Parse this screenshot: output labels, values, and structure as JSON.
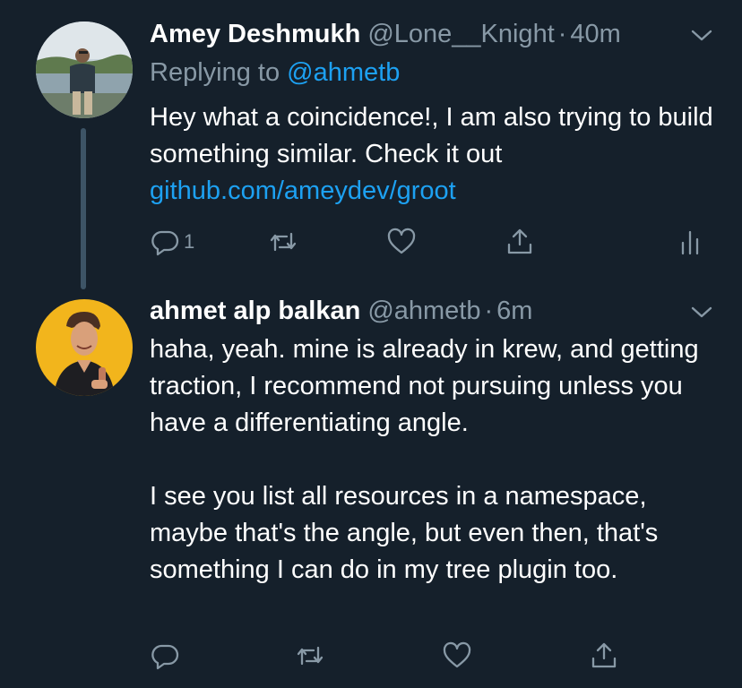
{
  "tweets": [
    {
      "author": "Amey Deshmukh",
      "handle": "@Lone__Knight",
      "separator": "·",
      "time": "40m",
      "replying_prefix": "Replying to",
      "replying_to": "@ahmetb",
      "text": "Hey what a coincidence!, I am also trying to build something similar. Check it out",
      "link": "github.com/ameydev/groot",
      "reply_count": "1",
      "actions": [
        "reply-icon",
        "retweet-icon",
        "like-icon",
        "share-icon",
        "analytics-icon"
      ]
    },
    {
      "author": "ahmet alp balkan",
      "handle": "@ahmetb",
      "separator": "·",
      "time": "6m",
      "text": "haha, yeah. mine is already in krew, and getting traction, I recommend not pursuing unless you have a differentiating angle.\n\nI see you list all resources in a namespace, maybe that's the angle, but even then, that's something I can do in my tree plugin too.",
      "actions": [
        "reply-icon",
        "retweet-icon",
        "like-icon",
        "share-icon"
      ]
    }
  ],
  "colors": {
    "background": "#15202b",
    "secondary_text": "#8899a6",
    "accent": "#1da1f2",
    "thread_line": "#3d5466"
  }
}
